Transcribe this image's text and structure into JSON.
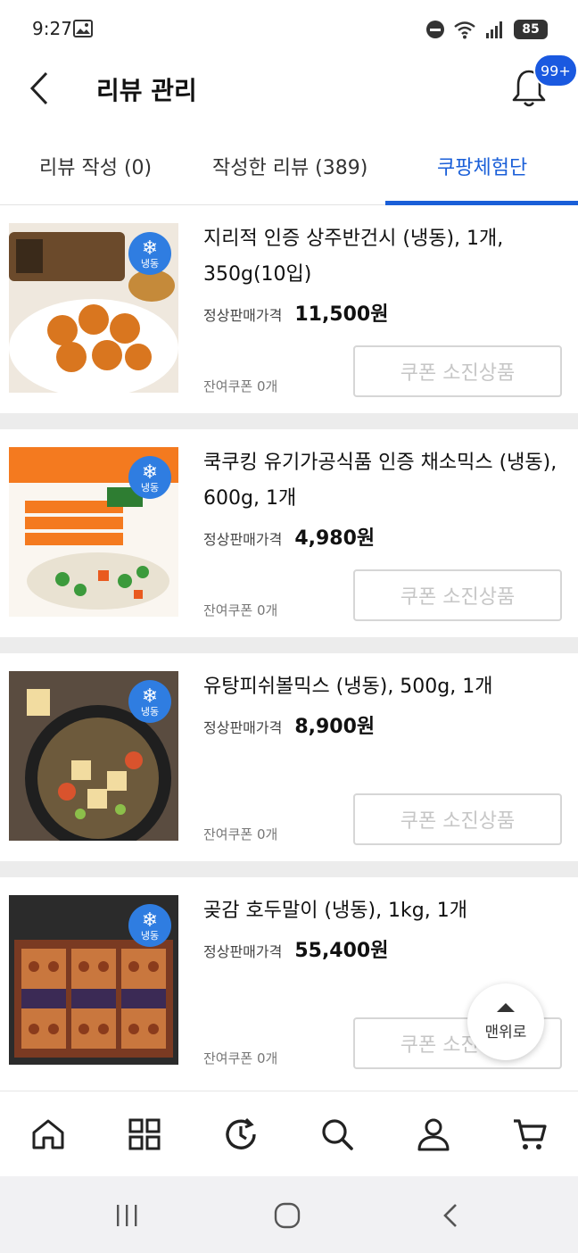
{
  "status_bar": {
    "time": "9:27",
    "battery": "85"
  },
  "header": {
    "title": "리뷰 관리",
    "notification_badge": "99+"
  },
  "tabs": [
    {
      "label": "리뷰 작성 (0)"
    },
    {
      "label": "작성한 리뷰 (389)"
    },
    {
      "label": "쿠팡체험단",
      "active": true
    }
  ],
  "products": [
    {
      "name": "지리적 인증 상주반건시 (냉동), 1개, 350g(10입)",
      "price_label": "정상판매가격",
      "price": "11,500원",
      "remaining": "잔여쿠폰 0개",
      "button": "쿠폰 소진상품",
      "badge": "냉동"
    },
    {
      "name": "쿡쿠킹 유기가공식품 인증 채소믹스 (냉동), 600g, 1개",
      "price_label": "정상판매가격",
      "price": "4,980원",
      "remaining": "잔여쿠폰 0개",
      "button": "쿠폰 소진상품",
      "badge": "냉동"
    },
    {
      "name": "유탕피쉬볼믹스 (냉동), 500g, 1개",
      "price_label": "정상판매가격",
      "price": "8,900원",
      "remaining": "잔여쿠폰 0개",
      "button": "쿠폰 소진상품",
      "badge": "냉동"
    },
    {
      "name": "곶감 호두말이 (냉동), 1kg, 1개",
      "price_label": "정상판매가격",
      "price": "55,400원",
      "remaining": "잔여쿠폰 0개",
      "button": "쿠폰 소진상품",
      "badge": "냉동"
    }
  ],
  "scroll_top": {
    "label": "맨위로"
  },
  "bottom_nav": [
    "home-icon",
    "categories-icon",
    "recent-icon",
    "search-icon",
    "profile-icon",
    "cart-icon"
  ],
  "colors": {
    "accent": "#1a5fd8",
    "frozen_badge": "#2f7de1",
    "badge": "#1a59e0"
  }
}
